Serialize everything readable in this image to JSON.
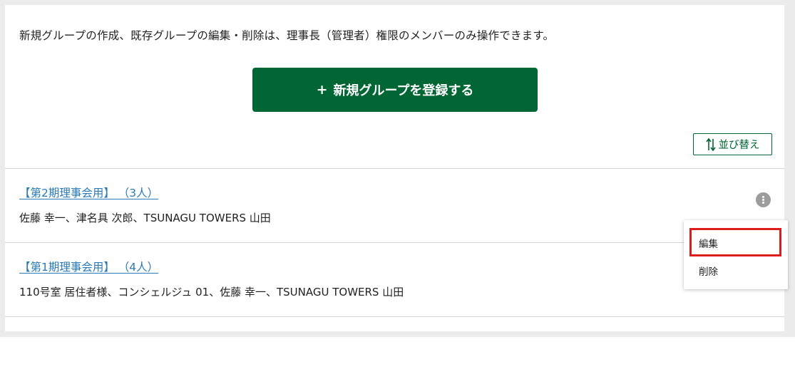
{
  "notice_text": "新規グループの作成、既存グループの編集・削除は、理事長（管理者）権限のメンバーのみ操作できます。",
  "new_group_button": {
    "icon": "plus-icon",
    "label": "新規グループを登録する",
    "bg_color": "#006633"
  },
  "sort_button": {
    "icon": "sort-arrows-icon",
    "label": "並び替え"
  },
  "groups": [
    {
      "title": "【第2期理事会用】 （3人）",
      "members": "佐藤 幸一、津名具 次郎、TSUNAGU TOWERS 山田"
    },
    {
      "title": "【第1期理事会用】 （4人）",
      "members": "110号室 居住者様、コンシェルジュ 01、佐藤 幸一、TSUNAGU TOWERS 山田"
    }
  ],
  "context_menu": {
    "trigger_icon": "more-vertical-icon",
    "items": [
      "編集",
      "削除"
    ],
    "highlight_color": "#e01b1b"
  }
}
